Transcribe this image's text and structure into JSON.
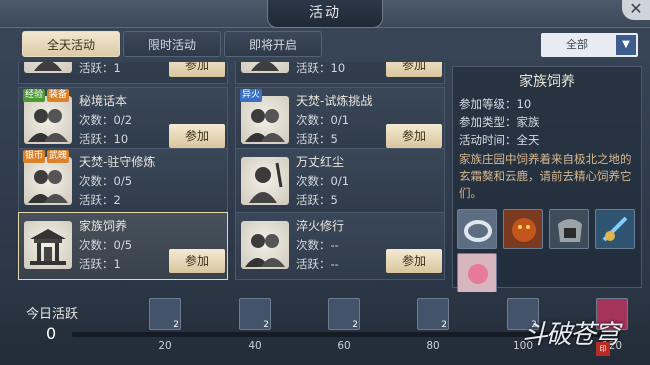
{
  "window": {
    "title": "活动",
    "close_icon": "close-icon"
  },
  "tabs": [
    {
      "label": "全天活动",
      "active": true
    },
    {
      "label": "限时活动",
      "active": false
    },
    {
      "label": "即将开启",
      "active": false
    }
  ],
  "filter": {
    "selected": "全部"
  },
  "activities": [
    {
      "name": "",
      "times": "",
      "active": "活跃：1",
      "join": "参加",
      "cut": true
    },
    {
      "name": "",
      "times": "",
      "active": "活跃：10",
      "join": "参加",
      "cut": true
    },
    {
      "name": "秘境话本",
      "times": "次数：0/2",
      "active": "活跃：10",
      "join": "参加",
      "badges": [
        "经验",
        "装备"
      ]
    },
    {
      "name": "天焚-试炼挑战",
      "times": "次数：0/1",
      "active": "活跃：5",
      "join": "参加",
      "badges": [
        "异火"
      ]
    },
    {
      "name": "天焚-驻守修炼",
      "times": "次数：0/5",
      "active": "活跃：2",
      "join": "参加",
      "badges": [
        "银币",
        "武魄"
      ]
    },
    {
      "name": "万丈红尘",
      "times": "次数：0/1",
      "active": "活跃：5",
      "join": ""
    },
    {
      "name": "家族饲养",
      "times": "次数：0/5",
      "active": "活跃：1",
      "join": "参加",
      "selected": true
    },
    {
      "name": "淬火修行",
      "times": "次数：--",
      "active": "活跃：--",
      "join": "参加"
    }
  ],
  "detail": {
    "title": "家族饲养",
    "level": "参加等级：10",
    "type": "参加类型：家族",
    "time": "活动时间：全天",
    "description": "家族庄园中饲养着来自极北之地的玄霜獒和云鹿，请前去精心饲养它们。"
  },
  "rewards": [
    "ring-item",
    "beast-item",
    "armor-item",
    "sword-item",
    "pink-orb-item"
  ],
  "daily": {
    "label": "今日活跃",
    "value": "0",
    "progress": 0,
    "milestones": [
      {
        "value": "20",
        "count": "2"
      },
      {
        "value": "40",
        "count": "2"
      },
      {
        "value": "60",
        "count": "2"
      },
      {
        "value": "80",
        "count": "2"
      },
      {
        "value": "100",
        "count": "2"
      },
      {
        "value": "120",
        "count": ""
      }
    ]
  },
  "logo_text": "斗破苍穹",
  "colors": {
    "accent": "#d9c69e",
    "tab_active": "#f2e7cf",
    "desc": "#d8b890"
  }
}
